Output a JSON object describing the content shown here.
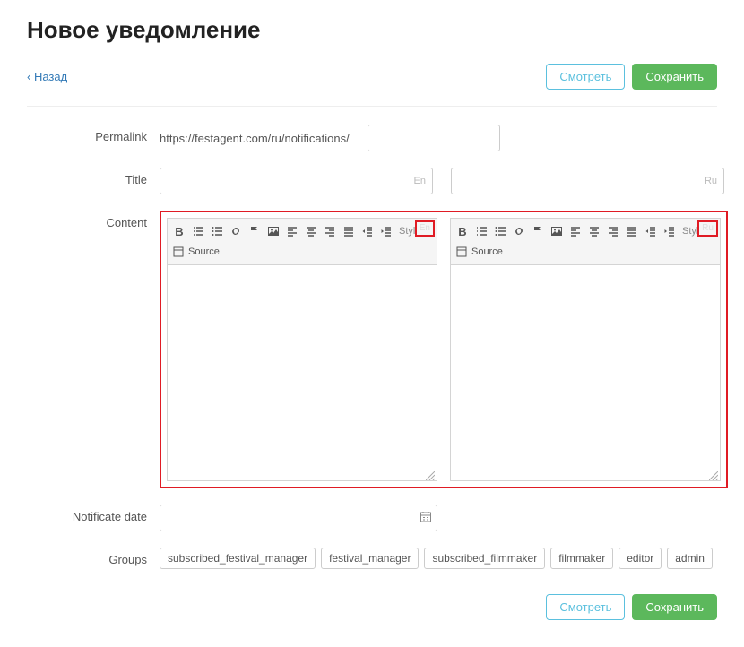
{
  "header": {
    "title": "Новое уведомление"
  },
  "nav": {
    "back": "‹  Назад"
  },
  "actions": {
    "preview": "Смотреть",
    "save": "Сохранить"
  },
  "labels": {
    "permalink": "Permalink",
    "title": "Title",
    "content": "Content",
    "notificate_date": "Notificate date",
    "groups": "Groups"
  },
  "permalink": {
    "base": "https://festagent.com/ru/notifications/",
    "slug": ""
  },
  "title_field": {
    "en_value": "",
    "en_tag": "En",
    "ru_value": "",
    "ru_tag": "Ru"
  },
  "editor": {
    "styles_label": "Styles",
    "source_label": "Source",
    "en_tag": "En",
    "ru_tag": "Ru"
  },
  "notificate_date": {
    "value": ""
  },
  "groups": [
    "subscribed_festival_manager",
    "festival_manager",
    "subscribed_filmmaker",
    "filmmaker",
    "editor",
    "admin"
  ]
}
